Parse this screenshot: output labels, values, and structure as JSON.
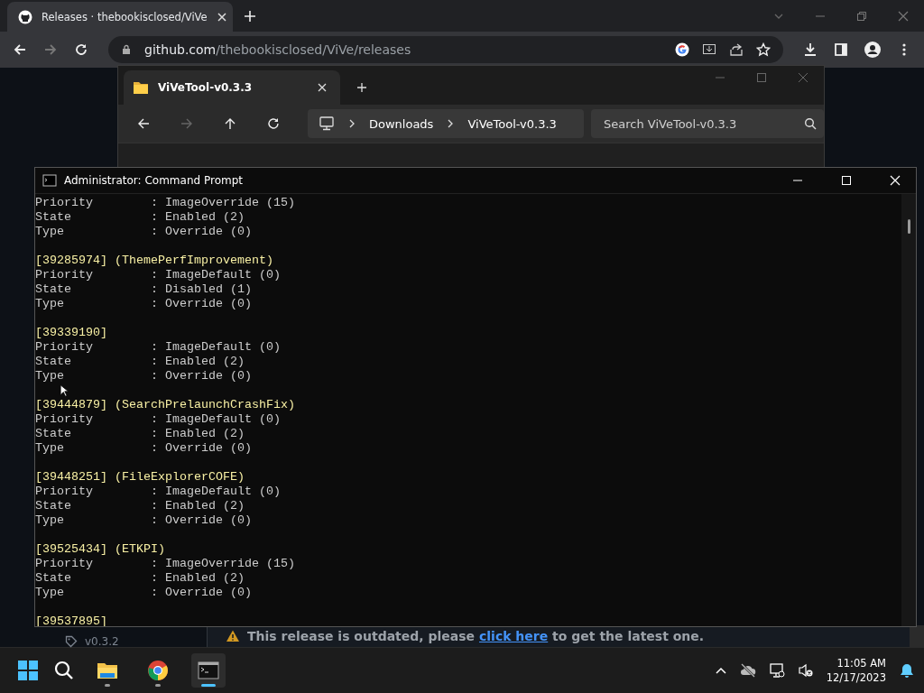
{
  "browser": {
    "tab": {
      "title": "Releases · thebookisclosed/ViVe"
    },
    "url": {
      "host": "github.com",
      "path": "/thebookisclosed/ViVe/releases"
    },
    "forward_disabled": true,
    "page": {
      "tag": "v0.3.2",
      "banner": {
        "before": "This release is outdated, please",
        "link": "click here",
        "after": "to get the latest one."
      }
    }
  },
  "explorer": {
    "tab": {
      "title": "ViVeTool-v0.3.3"
    },
    "forward_disabled": true,
    "breadcrumb": [
      "Downloads",
      "ViVeTool-v0.3.3"
    ],
    "search": {
      "placeholder": "Search ViVeTool-v0.3.3"
    }
  },
  "console": {
    "title": "Administrator: Command Prompt",
    "blocks": [
      {
        "fields": [
          "Priority        : ImageOverride (15)",
          "State           : Enabled (2)",
          "Type            : Override (0)"
        ]
      },
      {
        "header": "[39285974] (ThemePerfImprovement)",
        "fields": [
          "Priority        : ImageDefault (0)",
          "State           : Disabled (1)",
          "Type            : Override (0)"
        ]
      },
      {
        "header": "[39339190]",
        "fields": [
          "Priority        : ImageDefault (0)",
          "State           : Enabled (2)",
          "Type            : Override (0)"
        ]
      },
      {
        "header": "[39444879] (SearchPrelaunchCrashFix)",
        "fields": [
          "Priority        : ImageDefault (0)",
          "State           : Enabled (2)",
          "Type            : Override (0)"
        ]
      },
      {
        "header": "[39448251] (FileExplorerCOFE)",
        "fields": [
          "Priority        : ImageDefault (0)",
          "State           : Enabled (2)",
          "Type            : Override (0)"
        ]
      },
      {
        "header": "[39525434] (ETKPI)",
        "fields": [
          "Priority        : ImageOverride (15)",
          "State           : Enabled (2)",
          "Type            : Override (0)"
        ]
      },
      {
        "header": "[39537895]"
      }
    ]
  },
  "taskbar": {
    "apps": [
      {
        "kind": "explorer",
        "running": true,
        "selected": false
      },
      {
        "kind": "chrome",
        "running": true,
        "selected": false
      },
      {
        "kind": "terminal",
        "running": true,
        "selected": true
      }
    ],
    "clock": {
      "time": "11:05 AM",
      "date": "12/17/2023"
    }
  }
}
